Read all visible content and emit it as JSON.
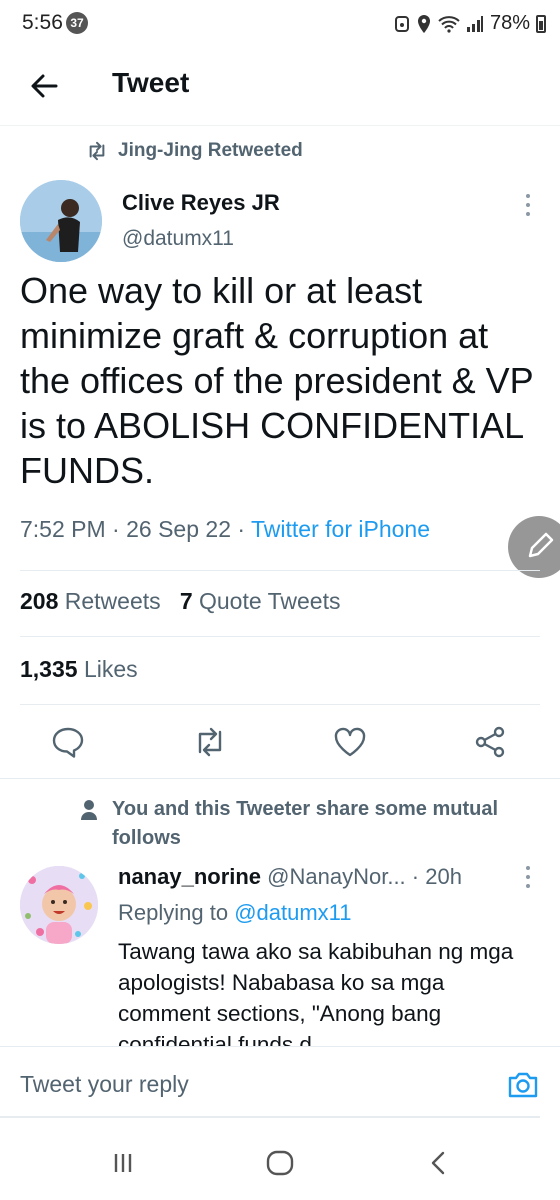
{
  "status_bar": {
    "time": "5:56",
    "notif_count": "37",
    "battery": "78%"
  },
  "header": {
    "title": "Tweet"
  },
  "retweet_context": {
    "text": "Jing-Jing Retweeted"
  },
  "tweet": {
    "author_name": "Clive Reyes JR",
    "author_handle": "@datumx11",
    "text": "One way to kill or at least minimize graft & corruption at the offices of the president & VP is to ABOLISH CONFIDENTIAL FUNDS.",
    "time": "7:52 PM",
    "date": "26 Sep 22",
    "source": "Twitter for iPhone",
    "sep": " · "
  },
  "stats": {
    "retweets_count": "208",
    "retweets_label": "Retweets",
    "quotes_count": "7",
    "quotes_label": "Quote Tweets",
    "likes_count": "1,335",
    "likes_label": "Likes"
  },
  "social_context": {
    "text": "You and this Tweeter share some mutual follows"
  },
  "reply": {
    "name": "nanay_norine",
    "handle": "@NanayNor...",
    "time": "20h",
    "replying_prefix": "Replying to",
    "replying_to": "@datumx11",
    "text": "Tawang tawa ako sa kabibuhan ng mga apologists! Nababasa ko sa mga comment sections, \"Anong bang confidential funds d..."
  },
  "composer": {
    "placeholder": "Tweet your reply"
  },
  "colors": {
    "accent": "#1d9bf0",
    "secondary_text": "#536471",
    "primary_text": "#0f1419"
  },
  "icons": [
    "back-arrow-icon",
    "retweet-icon",
    "more-vertical-icon",
    "reply-icon",
    "heart-icon",
    "share-icon",
    "person-icon",
    "camera-icon",
    "edit-icon"
  ]
}
